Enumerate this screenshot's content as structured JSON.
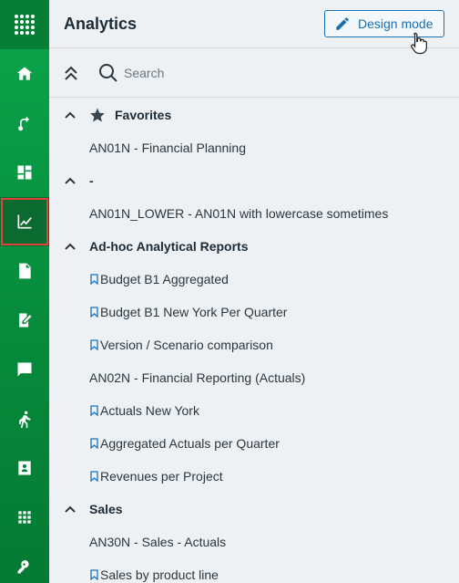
{
  "rail": {
    "items": [
      {
        "icon": "apps-grid-icon"
      },
      {
        "icon": "home-icon"
      },
      {
        "icon": "route-icon"
      },
      {
        "icon": "dashboard-icon"
      },
      {
        "icon": "analytics-chart-icon",
        "active": true
      },
      {
        "icon": "document-icon"
      },
      {
        "icon": "edit-document-icon"
      },
      {
        "icon": "chat-icon"
      },
      {
        "icon": "run-icon"
      },
      {
        "icon": "contact-card-icon"
      },
      {
        "icon": "apps-small-grid-icon"
      },
      {
        "icon": "key-icon"
      }
    ],
    "active_outline_color": "#e0433a"
  },
  "header": {
    "title": "Analytics",
    "design_mode_label": "Design mode"
  },
  "search": {
    "placeholder": "Search",
    "value": ""
  },
  "groups": [
    {
      "label": "Favorites",
      "has_star": true,
      "items": [
        {
          "label": "AN01N - Financial Planning",
          "bookmark": false
        }
      ]
    },
    {
      "label": "-",
      "has_star": false,
      "items": [
        {
          "label": "AN01N_LOWER - AN01N with lowercase sometimes",
          "bookmark": false
        }
      ]
    },
    {
      "label": "Ad-hoc Analytical Reports",
      "has_star": false,
      "items": [
        {
          "label": "Budget B1 Aggregated",
          "bookmark": true
        },
        {
          "label": "Budget B1 New York Per Quarter",
          "bookmark": true
        },
        {
          "label": "Version / Scenario comparison",
          "bookmark": true
        },
        {
          "label": "AN02N - Financial Reporting (Actuals)",
          "bookmark": false
        },
        {
          "label": "Actuals New York",
          "bookmark": true
        },
        {
          "label": "Aggregated Actuals per Quarter",
          "bookmark": true
        },
        {
          "label": "Revenues per Project",
          "bookmark": true
        }
      ]
    },
    {
      "label": "Sales",
      "has_star": false,
      "items": [
        {
          "label": "AN30N - Sales - Actuals",
          "bookmark": false
        },
        {
          "label": "Sales by product line",
          "bookmark": true
        }
      ]
    }
  ],
  "colors": {
    "brand_green": "#0aa54a",
    "accent_blue": "#1a73b8"
  }
}
